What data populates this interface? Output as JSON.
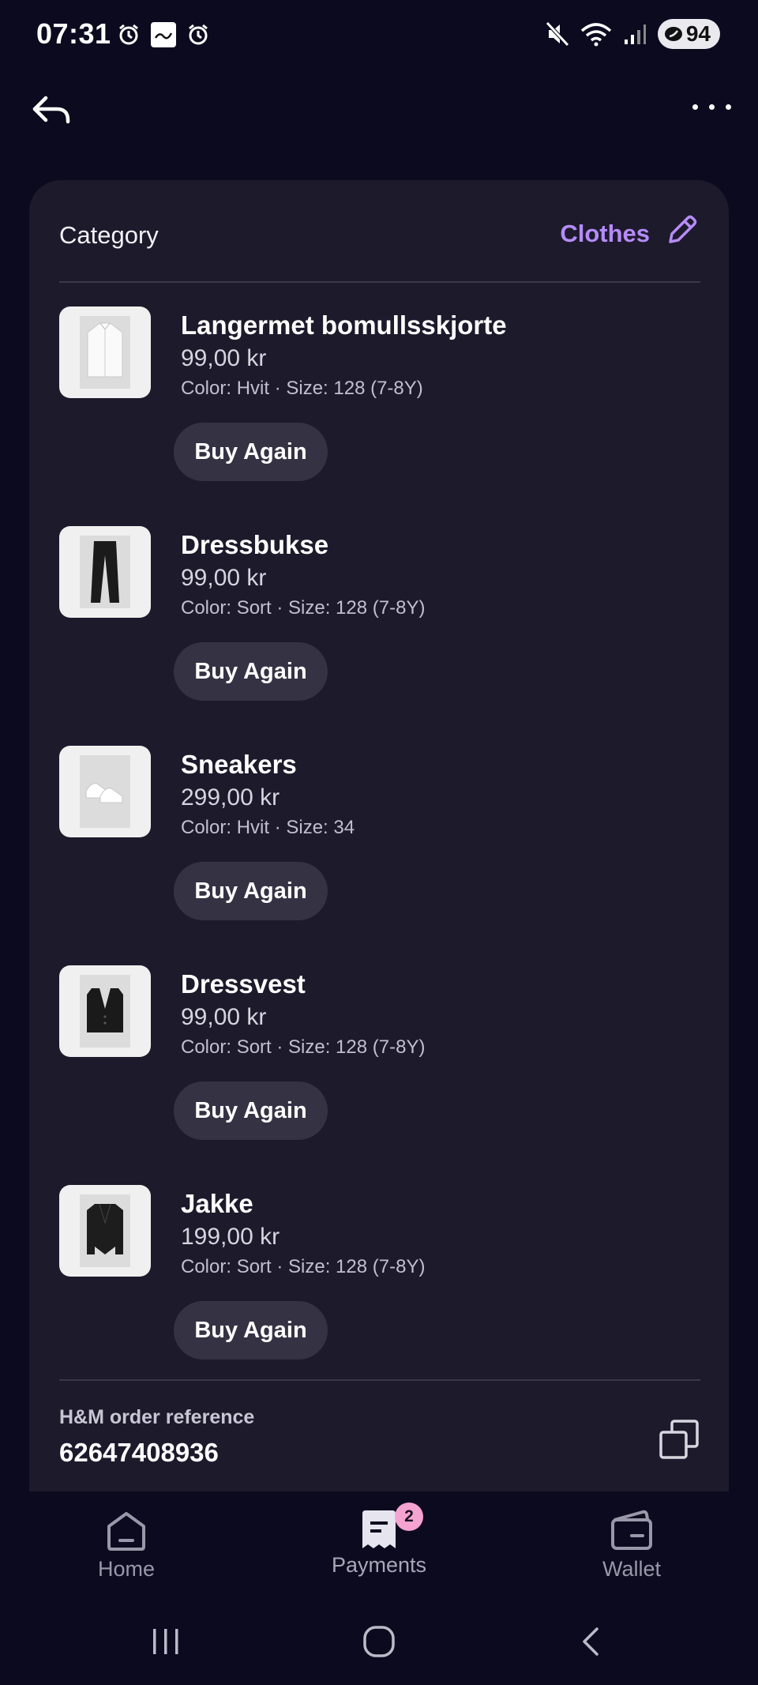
{
  "status_bar": {
    "time": "07:31",
    "battery": "94"
  },
  "category": {
    "label": "Category",
    "value": "Clothes"
  },
  "items": [
    {
      "name": "Langermet bomullsskjorte",
      "price": "99,00 kr",
      "meta": "Color: Hvit · Size: 128 (7-8Y)",
      "button": "Buy Again"
    },
    {
      "name": "Dressbukse",
      "price": "99,00 kr",
      "meta": "Color: Sort · Size: 128 (7-8Y)",
      "button": "Buy Again"
    },
    {
      "name": "Sneakers",
      "price": "299,00 kr",
      "meta": "Color: Hvit · Size: 34",
      "button": "Buy Again"
    },
    {
      "name": "Dressvest",
      "price": "99,00 kr",
      "meta": "Color: Sort · Size: 128 (7-8Y)",
      "button": "Buy Again"
    },
    {
      "name": "Jakke",
      "price": "199,00 kr",
      "meta": "Color: Sort · Size: 128 (7-8Y)",
      "button": "Buy Again"
    }
  ],
  "order_reference": {
    "label": "H&M order reference",
    "value": "62647408936"
  },
  "nav": {
    "home": "Home",
    "payments": "Payments",
    "payments_badge": "2",
    "wallet": "Wallet"
  },
  "colors": {
    "accent": "#b58cf7",
    "background": "#0c0a1f",
    "card": "#1d1a2c",
    "badge": "#f5a3d0"
  }
}
